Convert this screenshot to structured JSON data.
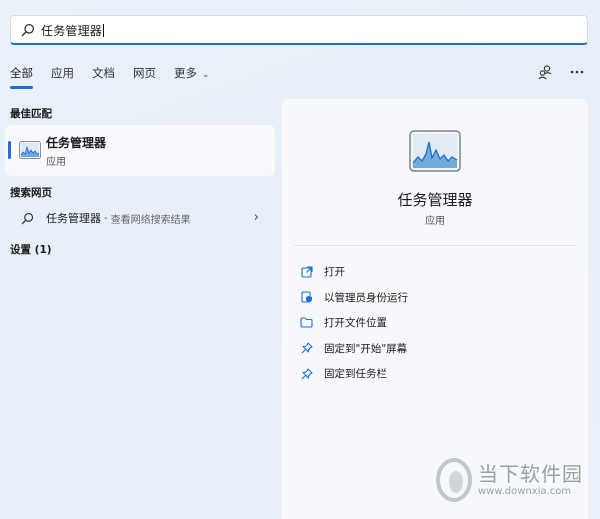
{
  "search": {
    "query": "任务管理器"
  },
  "tabs": [
    {
      "label": "全部",
      "active": true
    },
    {
      "label": "应用",
      "active": false
    },
    {
      "label": "文档",
      "active": false
    },
    {
      "label": "网页",
      "active": false
    },
    {
      "label": "更多",
      "active": false
    }
  ],
  "top_actions": {
    "account_icon": "people-share-icon",
    "more_icon": "more-ellipsis-icon"
  },
  "sections": {
    "best_match": "最佳匹配",
    "search_web": "搜索网页",
    "settings": "设置 (1)"
  },
  "best_match": {
    "title": "任务管理器",
    "subtitle": "应用",
    "icon": "task-manager-icon"
  },
  "web_result": {
    "query": "任务管理器",
    "separator": "-",
    "hint": "查看网络搜索结果",
    "arrow": "›"
  },
  "panel": {
    "title": "任务管理器",
    "subtitle": "应用",
    "actions": [
      {
        "label": "打开",
        "icon": "open-external-icon"
      },
      {
        "label": "以管理员身份运行",
        "icon": "admin-shield-icon"
      },
      {
        "label": "打开文件位置",
        "icon": "folder-icon"
      },
      {
        "label": "固定到\"开始\"屏幕",
        "icon": "pin-icon"
      },
      {
        "label": "固定到任务栏",
        "icon": "pin-icon"
      }
    ]
  },
  "watermark": {
    "name": "当下软件园",
    "url": "www.downxia.com"
  },
  "colors": {
    "accent": "#1f6fd0",
    "panel_bg": "#f6f8fb",
    "page_bg": "#e8eff8"
  }
}
